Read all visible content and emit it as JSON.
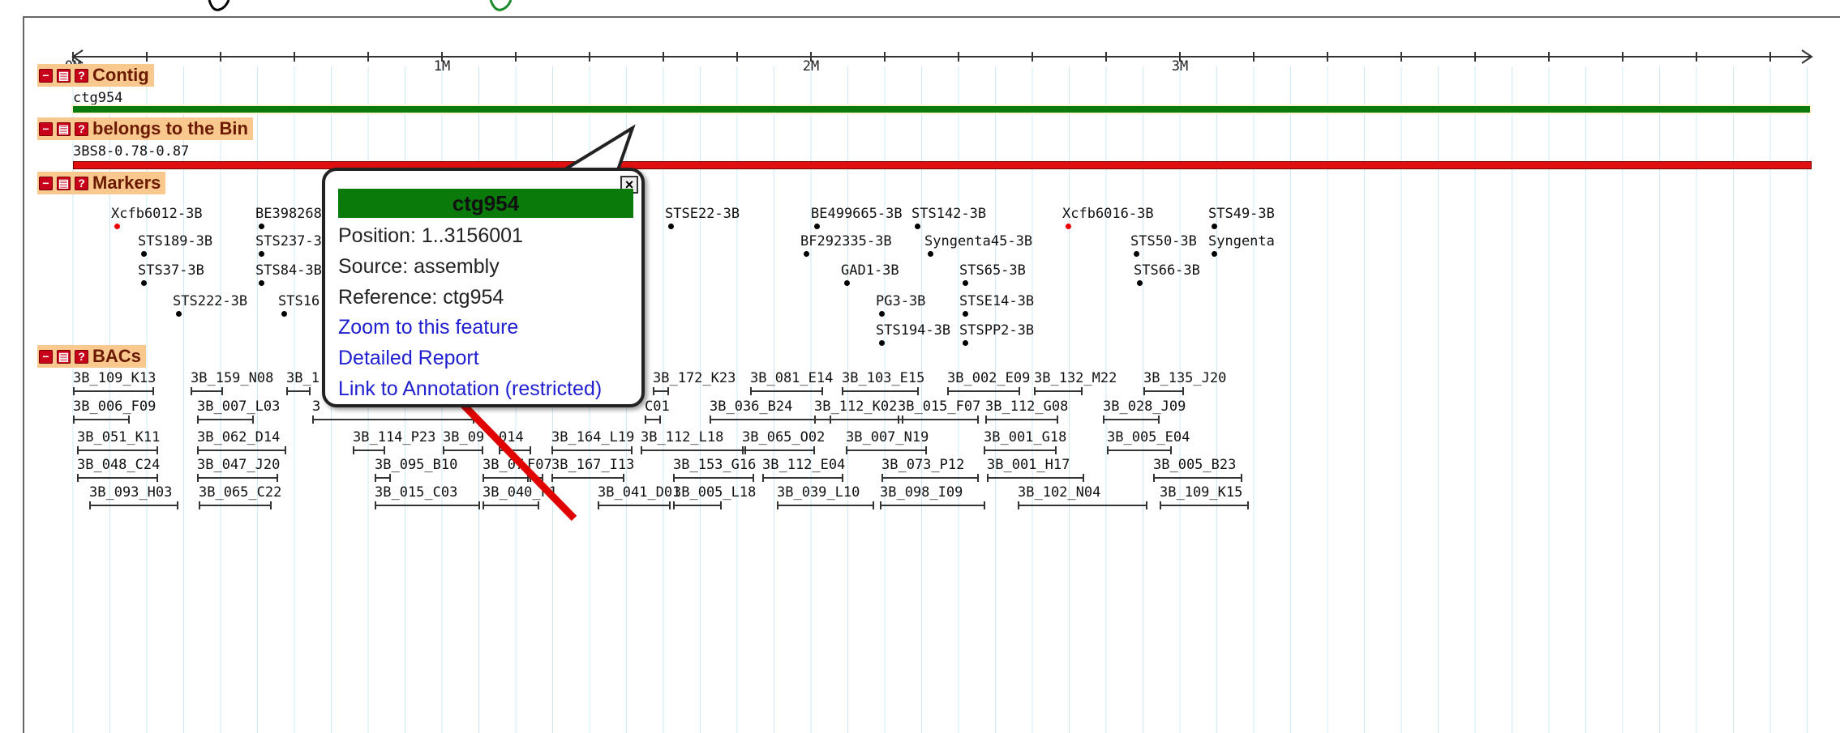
{
  "ruler": {
    "labels": [
      "0M",
      "1M",
      "2M",
      "3M"
    ]
  },
  "tracks": {
    "contig": {
      "title": "Contig",
      "feature": "ctg954",
      "color": "#0a7a0a"
    },
    "bin": {
      "title": "belongs to the Bin",
      "feature": "3BS8-0.78-0.87",
      "color": "#e01010"
    },
    "markers": {
      "title": "Markers",
      "items": [
        {
          "name": "Xcfb6012-3B",
          "color": "red"
        },
        {
          "name": "STS189-3B"
        },
        {
          "name": "STS37-3B"
        },
        {
          "name": "STS222-3B"
        },
        {
          "name": "BE398268"
        },
        {
          "name": "STS237-3"
        },
        {
          "name": "STS84-3B"
        },
        {
          "name": "STS16"
        },
        {
          "name": "STSE22-3B"
        },
        {
          "name": "BE499665-3B"
        },
        {
          "name": "BF292335-3B"
        },
        {
          "name": "STS142-3B"
        },
        {
          "name": "Syngenta45-3B"
        },
        {
          "name": "GAD1-3B"
        },
        {
          "name": "STS65-3B"
        },
        {
          "name": "PG3-3B"
        },
        {
          "name": "STSE14-3B"
        },
        {
          "name": "STS194-3B"
        },
        {
          "name": "STSPP2-3B"
        },
        {
          "name": "Xcfb6016-3B",
          "color": "red"
        },
        {
          "name": "STS49-3B"
        },
        {
          "name": "STS50-3B"
        },
        {
          "name": "Syngenta"
        },
        {
          "name": "STS66-3B"
        }
      ]
    },
    "bacs": {
      "title": "BACs",
      "items": [
        "3B_109_K13",
        "3B_159_N08",
        "3B_1",
        "3B_172_K23",
        "3B_081_E14",
        "3B_103_E15",
        "3B_002_E09",
        "3B_132_M22",
        "3B_135_J20",
        "3B_006_F09",
        "3B_007_L03",
        "3",
        "C01",
        "3B_036_B24",
        "3B_112_K02",
        "3B_015_F07",
        "3B_112_G08",
        "3B_028_J09",
        "3B_051_K11",
        "3B_062_D14",
        "3B_114_P23",
        "3B_09",
        "014",
        "3B_164_L19",
        "3B_112_L18",
        "3B_065_O02",
        "3B_007_N19",
        "3B_001_G18",
        "3B_005_E04",
        "3B_048_C24",
        "3B_047_J20",
        "3B_095_B10",
        "3B_07",
        "F07",
        "3B_167_I13",
        "3B_153_G16",
        "3B_112_E04",
        "3B_073_P12",
        "3B_001_H17",
        "3B_005_B23",
        "3B_093_H03",
        "3B_065_C22",
        "3B_015_C03",
        "3B_040_F1",
        "3B_041_D01",
        "3B_005_L18",
        "3B_039_L10",
        "3B_098_I09",
        "3B_102_N04",
        "3B_109_K15"
      ]
    }
  },
  "popup": {
    "title": "ctg954",
    "position": "Position: 1..3156001",
    "source": "Source: assembly",
    "reference": "Reference: ctg954",
    "zoom_link": "Zoom to this feature",
    "report_link": "Detailed Report",
    "annotation_link": "Link to Annotation (restricted)",
    "close": "×"
  },
  "track_buttons": {
    "minus": "−",
    "share": "▤",
    "help": "?"
  },
  "colors": {
    "header_bg": "#f9c88f",
    "popup_title_bg": "#0a7a0a",
    "link": "#2020d0",
    "arrow": "#e00000"
  }
}
